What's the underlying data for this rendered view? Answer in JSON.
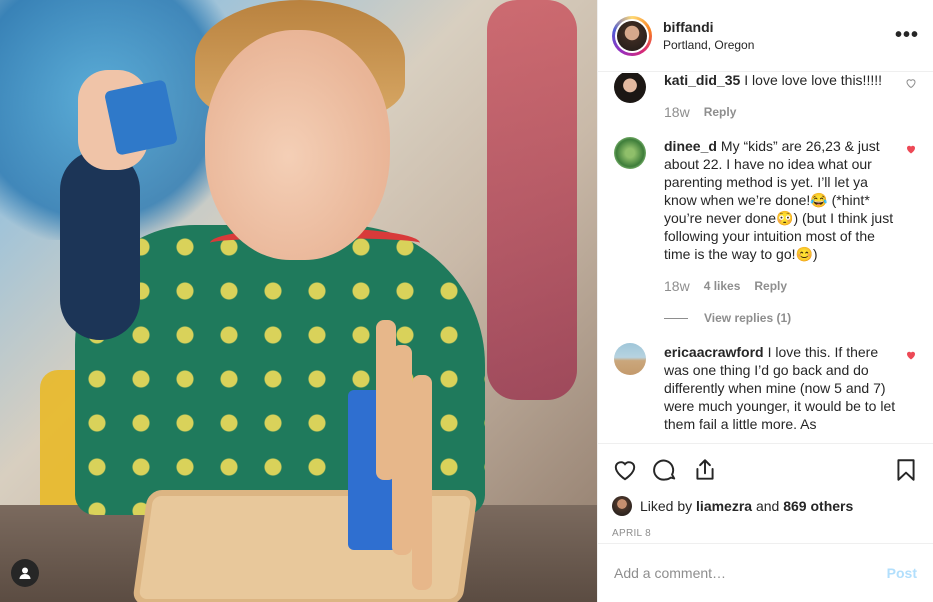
{
  "post": {
    "username": "biffandi",
    "location": "Portland, Oregon",
    "more_label": "•••"
  },
  "comments": [
    {
      "username": "kati_did_35",
      "text": "I love love love this!!!!!",
      "time": "18w",
      "likes": "",
      "reply_label": "Reply",
      "liked": false
    },
    {
      "username": "dinee_d",
      "text": "My “kids” are 26,23 & just about 22. I have no idea what our parenting method is yet. I’ll let ya know when we’re done!😂 (*hint* you’re never done😳) (but I think just following your intuition most of the time is the way to go!😊)",
      "time": "18w",
      "likes": "4 likes",
      "reply_label": "Reply",
      "view_replies": "View replies (1)",
      "liked": true
    },
    {
      "username": "ericaacrawford",
      "text": "I love this. If there was one thing I’d go back and do differently when mine (now 5 and 7) were much younger, it would be to let them fail a little more. As",
      "liked": true
    }
  ],
  "likes": {
    "prefix": "Liked by",
    "user": "liamezra",
    "connector": "and",
    "others": "869 others"
  },
  "date": "APRIL 8",
  "add_comment": {
    "placeholder": "Add a comment…",
    "post_label": "Post"
  },
  "colors": {
    "heart_red": "#ed4956",
    "post_disabled": "#b2dffc",
    "muted": "#8e8e8e"
  }
}
